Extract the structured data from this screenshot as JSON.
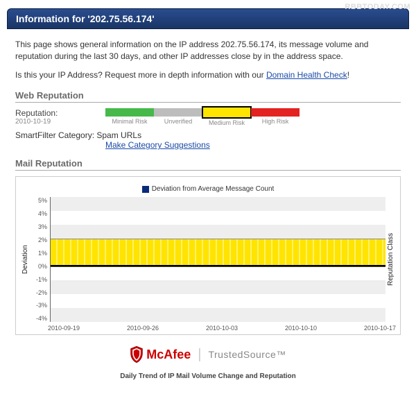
{
  "watermark": "RBBTODAY.COM",
  "header": {
    "title": "Information for '202.75.56.174'"
  },
  "intro": {
    "p1": "This page shows general information on the IP address 202.75.56.174, its message volume and reputation during the last 30 days, and other IP addresses close by in the address space.",
    "p2_prefix": "Is this your IP Address? Request more in depth information with our ",
    "p2_link": "Domain Health Check",
    "p2_suffix": "!"
  },
  "web_rep": {
    "title": "Web Reputation",
    "rep_label": "Reputation:",
    "rep_date": "2010-10-19",
    "segments": {
      "minimal": "Minimal Risk",
      "unverified": "Unverified",
      "medium": "Medium Risk",
      "high": "High Risk"
    },
    "selected": "medium",
    "sf_label": "SmartFilter Category:",
    "sf_value": "Spam URLs",
    "sf_link": "Make Category Suggestions"
  },
  "mail_rep": {
    "title": "Mail Reputation",
    "legend": "Deviation from Average Message Count",
    "y_label_left": "Deviation",
    "y_label_right": "Reputation Class",
    "y_ticks": [
      "5%",
      "4%",
      "3%",
      "2%",
      "1%",
      "0%",
      "-1%",
      "-2%",
      "-3%",
      "-4%"
    ],
    "x_ticks": [
      "2010-09-19",
      "2010-09-26",
      "2010-10-03",
      "2010-10-10",
      "2010-10-17"
    ],
    "caption": "Daily Trend of IP Mail Volume Change and Reputation"
  },
  "brand": {
    "mcafee": "McAfee",
    "trustedsource": "TrustedSource™"
  },
  "chart_data": {
    "type": "area",
    "title": "Deviation from Average Message Count",
    "xlabel": "",
    "ylabel": "Deviation",
    "ylim": [
      -4,
      5
    ],
    "x": [
      "2010-09-19",
      "2010-09-26",
      "2010-10-03",
      "2010-10-10",
      "2010-10-17"
    ],
    "series": [
      {
        "name": "Reputation Class band",
        "values_low": [
          0,
          0,
          0,
          0,
          0
        ],
        "values_high": [
          2,
          2,
          2,
          2,
          2
        ],
        "class": "Medium Risk"
      },
      {
        "name": "Deviation from Average Message Count",
        "values": [
          null,
          null,
          null,
          null,
          null
        ]
      }
    ]
  }
}
